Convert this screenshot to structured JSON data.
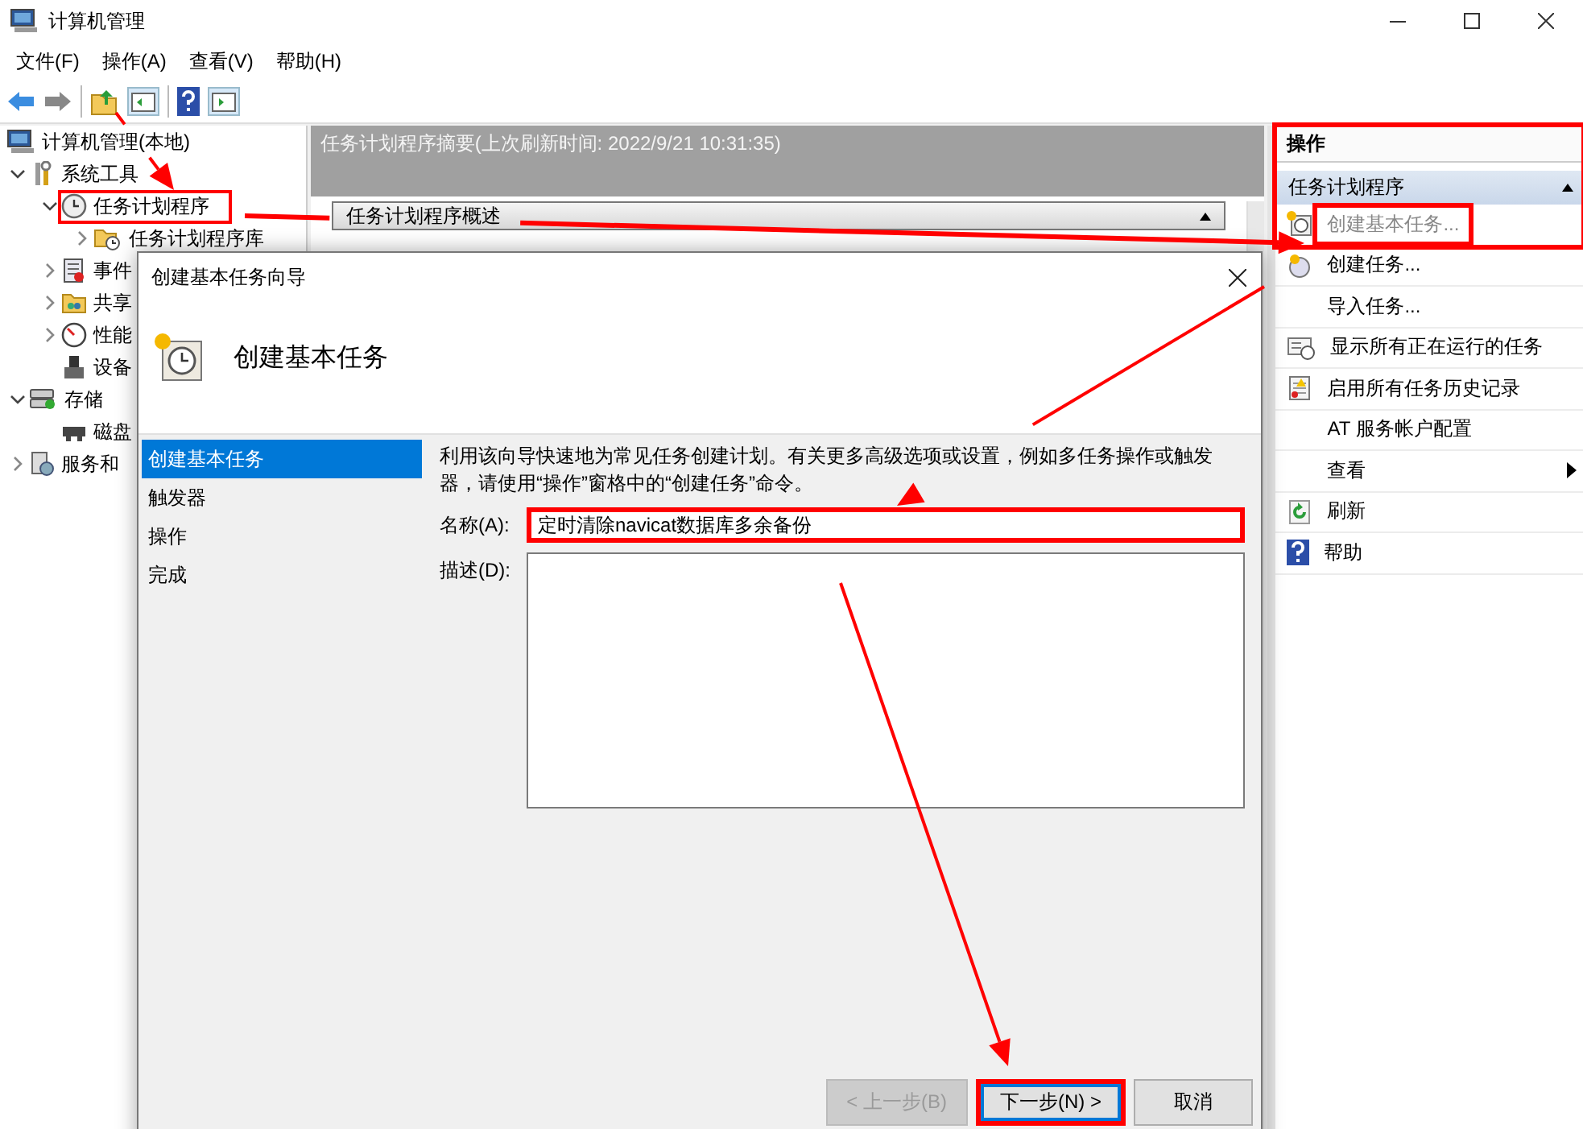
{
  "window": {
    "title": "计算机管理"
  },
  "menu": [
    "文件(F)",
    "操作(A)",
    "查看(V)",
    "帮助(H)"
  ],
  "tree": [
    {
      "label": "计算机管理(本地)",
      "highlighted": false,
      "children": [
        {
          "label": "系统工具",
          "expanded": true,
          "highlighted": false,
          "children": [
            {
              "label": "任务计划程序",
              "expanded": true,
              "highlighted": true,
              "children": [
                {
                  "label": "任务计划程序库",
                  "expanded": false,
                  "highlighted": false
                }
              ]
            },
            {
              "label": "事件",
              "expanded": false,
              "highlighted": false
            },
            {
              "label": "共享",
              "expanded": false,
              "highlighted": false
            },
            {
              "label": "性能",
              "expanded": false,
              "highlighted": false
            },
            {
              "label": "设备",
              "highlighted": false
            }
          ]
        },
        {
          "label": "存储",
          "expanded": true,
          "highlighted": false,
          "children": [
            {
              "label": "磁盘",
              "highlighted": false
            }
          ]
        },
        {
          "label": "服务和",
          "expanded": false,
          "highlighted": false
        }
      ]
    }
  ],
  "summary": {
    "title": "任务计划程序摘要(上次刷新时间: 2022/9/21 10:31:35)",
    "section": {
      "label": "任务计划程序概述",
      "expanded": true
    }
  },
  "actions": {
    "header": "操作",
    "highlighted": true,
    "section": {
      "label": "任务计划程序",
      "expanded": true
    },
    "items": [
      {
        "label": "创建基本任务...",
        "kind": "command",
        "disabled": true,
        "highlighted": true
      },
      {
        "label": "创建任务...",
        "kind": "command",
        "disabled": false,
        "highlighted": false
      },
      {
        "label": "导入任务...",
        "kind": "command",
        "disabled": false,
        "highlighted": false
      },
      {
        "label": "显示所有正在运行的任务",
        "kind": "command",
        "disabled": false,
        "highlighted": false
      },
      {
        "label": "启用所有任务历史记录",
        "kind": "command",
        "disabled": false,
        "highlighted": false
      },
      {
        "label": "AT 服务帐户配置",
        "kind": "command",
        "disabled": false,
        "highlighted": false
      },
      {
        "label": "查看",
        "kind": "submenu",
        "disabled": false,
        "highlighted": false
      },
      {
        "label": "刷新",
        "kind": "command",
        "disabled": false,
        "highlighted": false
      },
      {
        "label": "帮助",
        "kind": "command",
        "disabled": false,
        "highlighted": false
      }
    ]
  },
  "dialog": {
    "title": "创建基本任务向导",
    "heading": "创建基本任务",
    "steps": [
      {
        "label": "创建基本任务",
        "selected": true
      },
      {
        "label": "触发器",
        "selected": false
      },
      {
        "label": "操作",
        "selected": false
      },
      {
        "label": "完成",
        "selected": false
      }
    ],
    "intro": "利用该向导快速地为常见任务创建计划。有关更多高级选项或设置，例如多任务操作或触发器，请使用“操作”窗格中的“创建任务”命令。",
    "name_label": "名称(A):",
    "name_value": "定时清除navicat数据库多余备份",
    "name_highlighted": true,
    "description_label": "描述(D):",
    "buttons": [
      {
        "label": "< 上一步(B)",
        "disabled": true,
        "selected": false,
        "highlighted": false
      },
      {
        "label": "下一步(N) >",
        "disabled": false,
        "selected": true,
        "highlighted": true
      },
      {
        "label": "取消",
        "disabled": false,
        "selected": false,
        "highlighted": false
      }
    ]
  }
}
